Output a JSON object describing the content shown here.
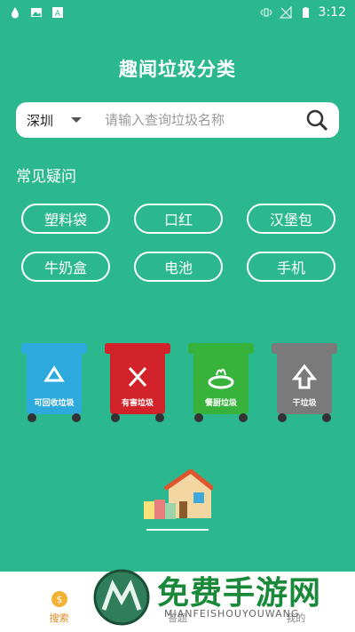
{
  "status": {
    "time": "3:12"
  },
  "app_title": "趣闻垃圾分类",
  "search": {
    "city": "深圳",
    "placeholder": "请输入查询垃圾名称"
  },
  "faq": {
    "title": "常见疑问",
    "tags": [
      "塑料袋",
      "口红",
      "汉堡包",
      "牛奶盒",
      "电池",
      "手机"
    ]
  },
  "bins": [
    {
      "label": "可回收垃圾",
      "color": "#2ea9de",
      "icon": "recycle-icon"
    },
    {
      "label": "有害垃圾",
      "color": "#d3232a",
      "icon": "hazard-icon"
    },
    {
      "label": "餐厨垃圾",
      "color": "#37b33b",
      "icon": "food-icon"
    },
    {
      "label": "干垃圾",
      "color": "#7a7a7a",
      "icon": "residual-icon"
    }
  ],
  "tabbar": {
    "items": [
      {
        "label": "搜索",
        "active": true
      },
      {
        "label": "答题",
        "active": false
      },
      {
        "label": "我的",
        "active": false
      }
    ]
  },
  "watermark": {
    "text": "免费手游网",
    "sub": "MIANFEISHOUYOUWANG"
  }
}
